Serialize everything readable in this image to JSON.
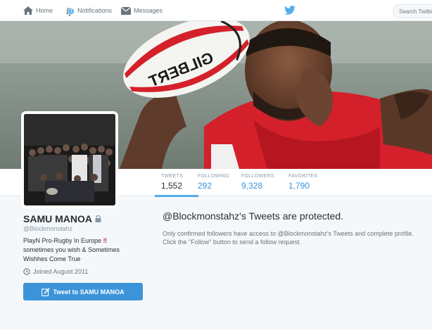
{
  "nav": {
    "home_label": "Home",
    "notifications_label": "Notifications",
    "notifications_count": "3",
    "messages_label": "Messages",
    "search_placeholder": "Search Twitter"
  },
  "colors": {
    "accent": "#55acee",
    "link": "#3b94d9",
    "banner_jersey": "#d4202a"
  },
  "profile": {
    "name": "SAMU MANOA",
    "handle": "@Blockmonstahz",
    "bio_line1": "PlayN Pro-Rugby In Europe",
    "bio_emoji": "‼",
    "bio_line2": "sometimes you wish & Sometimes Wishhes Come True",
    "joined": "Joined August 2011",
    "tweet_to_label": "Tweet to SAMU MANOA",
    "banner_ball_text": "GILBERT"
  },
  "stats": {
    "tweets_label": "TWEETS",
    "tweets_value": "1,552",
    "following_label": "FOLLOWING",
    "following_value": "292",
    "followers_label": "FOLLOWERS",
    "followers_value": "9,328",
    "favorites_label": "FAVORITES",
    "favorites_value": "1,790"
  },
  "protected": {
    "title": "@Blockmonstahz's Tweets are protected.",
    "line1": "Only confirmed followers have access to @Blockmonstahz's Tweets and complete profile.",
    "line2": "Click the \"Follow\" button to send a follow request."
  }
}
